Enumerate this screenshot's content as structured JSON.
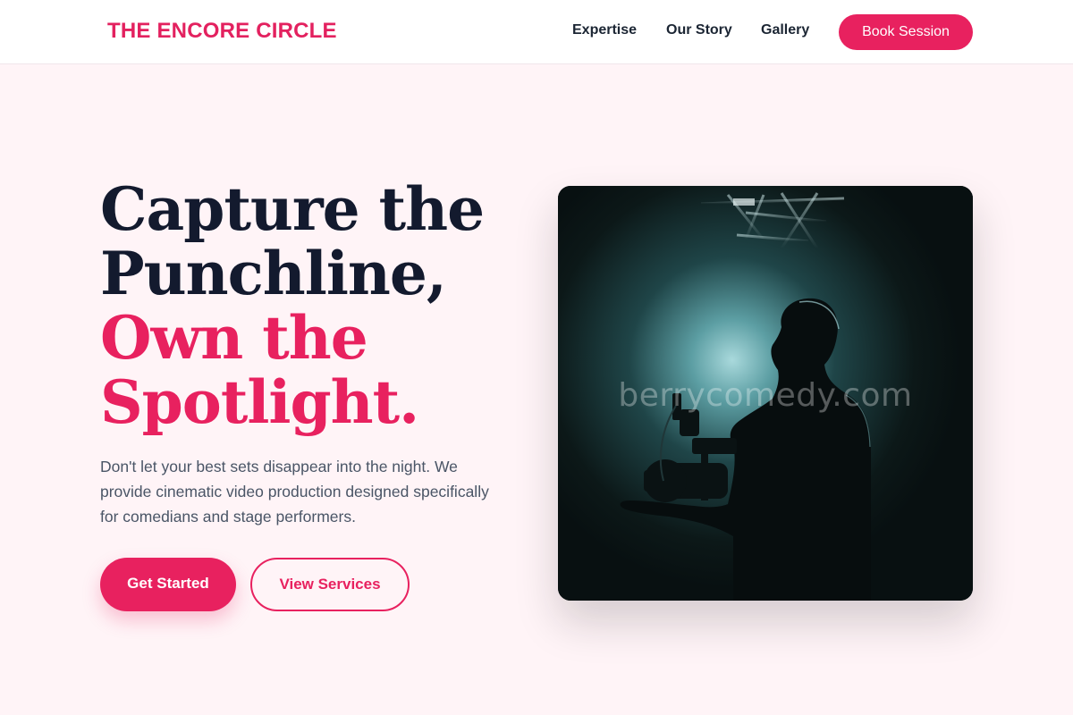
{
  "brand": {
    "name": "THE ENCORE CIRCLE"
  },
  "nav": {
    "links": [
      "Expertise",
      "Our Story",
      "Gallery"
    ],
    "cta": "Book Session"
  },
  "hero": {
    "title_lines": [
      "Capture the",
      "Punchline,"
    ],
    "title_accent_lines": [
      "Own the",
      "Spotlight."
    ],
    "description": "Don't let your best sets disappear into the night. We provide cinematic video production designed specifically for comedians and stage performers.",
    "primary_button": "Get Started",
    "secondary_button": "View Services",
    "image": {
      "watermark": "berrycomedy.com",
      "icon": "camera-operator-silhouette"
    }
  },
  "colors": {
    "accent": "#e8215f",
    "heading": "#131a2e",
    "background": "#fff4f7"
  }
}
